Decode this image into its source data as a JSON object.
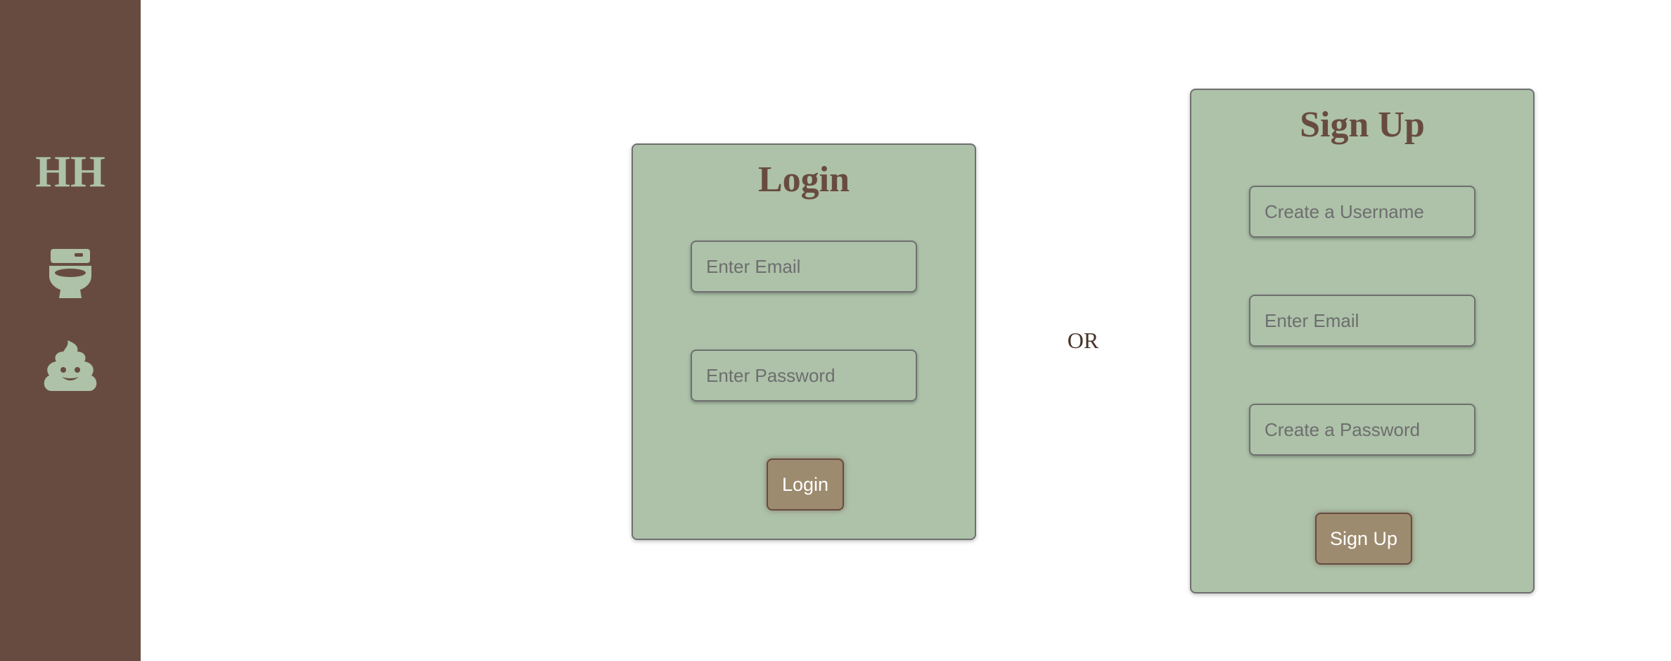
{
  "sidebar": {
    "brand": "HH",
    "items": [
      {
        "icon": "toilet-icon"
      },
      {
        "icon": "poop-icon"
      }
    ]
  },
  "login": {
    "title": "Login",
    "email_placeholder": "Enter Email",
    "password_placeholder": "Enter Password",
    "button_label": "Login"
  },
  "separator": "OR",
  "signup": {
    "title": "Sign Up",
    "username_placeholder": "Create a Username",
    "email_placeholder": "Enter Email",
    "password_placeholder": "Create a Password",
    "button_label": "Sign Up"
  },
  "colors": {
    "sidebar_bg": "#684b40",
    "accent_green": "#adc2a9",
    "button_bg": "#9d8b6f",
    "title_text": "#684b40"
  }
}
